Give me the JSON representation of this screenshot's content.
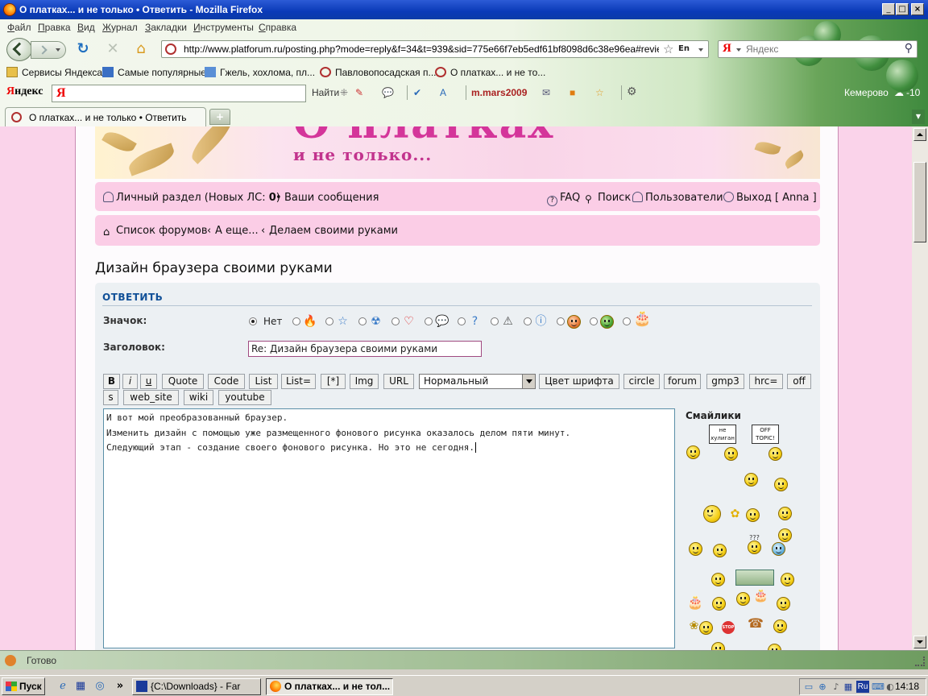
{
  "window": {
    "title": "О платках... и не только • Ответить - Mozilla Firefox",
    "minimize": "_",
    "maximize": "□",
    "close": "×"
  },
  "menu": [
    "Файл",
    "Правка",
    "Вид",
    "Журнал",
    "Закладки",
    "Инструменты",
    "Справка"
  ],
  "nav": {
    "url": "http://www.platforum.ru/posting.php?mode=reply&f=34&t=939&sid=775e66f7eb5edf61bf8098d6c38e96ea#review",
    "lang_indicator": "En",
    "search_placeholder": "Яндекс",
    "search_engine_letter": "Я"
  },
  "bookmarks": [
    "Сервисы Яндекса",
    "Самые популярные",
    "Гжель, хохлома, пл...",
    "Павловопосадская п...",
    "О платках... и не то..."
  ],
  "yandex_bar": {
    "logo_prefix": "Я",
    "logo_rest": "ндекс",
    "input_letter": "Я",
    "find": "Найти",
    "mail_user": "m.mars2009",
    "weather": "Кемерово",
    "temperature": "-10"
  },
  "tab": {
    "title": "О платках... и не только • Ответить",
    "new_tab": "+"
  },
  "banner": {
    "big_text": "О платках",
    "sub_text": "и не только..."
  },
  "userbar": {
    "personal": "Личный раздел (Новых ЛС: ",
    "new_count": "0",
    "personal_close": ")",
    "bullet": "•",
    "my_posts": "Ваши сообщения",
    "faq": "FAQ",
    "search": "Поиск",
    "users": "Пользователи",
    "logout": "Выход [ Anna ]"
  },
  "breadcrumb": {
    "forums": "Список форумов",
    "sep": "‹",
    "level1": "А еще...",
    "level2": "Делаем своими руками"
  },
  "post": {
    "title": "Дизайн браузера своими руками",
    "panel_title": "ОТВЕТИТЬ",
    "icon_label": "Значок:",
    "icon_none": "Нет",
    "subject_label": "Заголовок:",
    "subject_value": "Re: Дизайн браузера своими руками",
    "message_lines": [
      "И вот мой преобразованный браузер.",
      "Изменить дизайн с помощью уже размещенного фонового рисунка оказалось делом пяти минут.",
      "Следующий этап - создание своего фонового рисунка. Но это не сегодня."
    ],
    "font_size": "Нормальный",
    "smilies_title": "Смайлики"
  },
  "bbcode_row1": [
    "B",
    "i",
    "u",
    "Quote",
    "Code",
    "List",
    "List=",
    "[*]",
    "Img",
    "URL"
  ],
  "bbcode_row1_after": [
    "Цвет шрифта",
    "circle",
    "forum",
    "gmp3",
    "hrc=",
    "off"
  ],
  "bbcode_row2": [
    "s",
    "web_site",
    "wiki",
    "youtube"
  ],
  "smiley_signs": {
    "sign1": "не хулиган",
    "sign2": "OFF TOPIC!",
    "stop": "STOP",
    "question": "???"
  },
  "status": {
    "text": "Готово"
  },
  "taskbar": {
    "start": "Пуск",
    "tasks": [
      "{C:\\Downloads} - Far",
      "О платках... и не тол..."
    ],
    "overflow": "»",
    "lang": "Ru",
    "clock": "14:18"
  },
  "colors": {
    "page_bg": "#fad3ea",
    "bar_pink": "#fbcde6",
    "panel_bg": "#ecf0f3",
    "link_blue": "#115098",
    "banner_magenta": "#d4359a",
    "titlebar_blue": "#0a3ab8"
  }
}
